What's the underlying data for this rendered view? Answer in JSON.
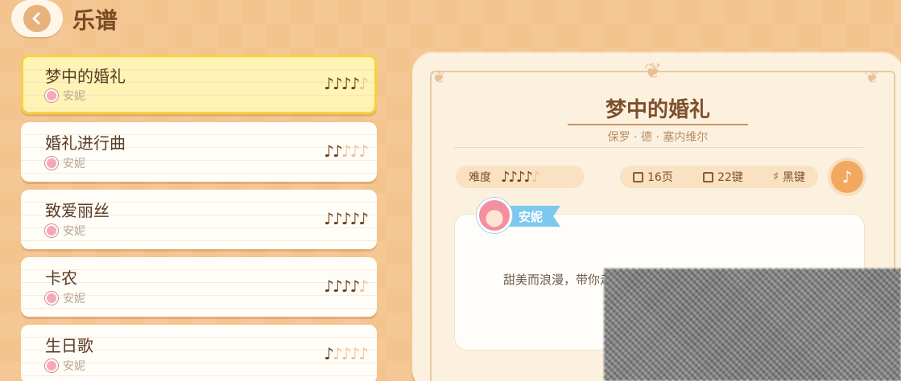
{
  "header": {
    "title": "乐谱"
  },
  "songs": [
    {
      "name": "梦中的婚礼",
      "artist": "安妮",
      "difficulty": 4,
      "max": 5,
      "selected": true
    },
    {
      "name": "婚礼进行曲",
      "artist": "安妮",
      "difficulty": 2,
      "max": 5,
      "selected": false
    },
    {
      "name": "致爱丽丝",
      "artist": "安妮",
      "difficulty": 5,
      "max": 5,
      "selected": false
    },
    {
      "name": "卡农",
      "artist": "安妮",
      "difficulty": 4,
      "max": 5,
      "selected": false
    },
    {
      "name": "生日歌",
      "artist": "安妮",
      "difficulty": 1,
      "max": 5,
      "selected": false
    }
  ],
  "detail": {
    "title": "梦中的婚礼",
    "composer": "保罗 · 德 · 塞内维尔",
    "difficulty_label": "难度",
    "difficulty": 4,
    "difficulty_max": 5,
    "pages": "16页",
    "keys": "22键",
    "key_type": "黑键",
    "speaker": "安妮",
    "description": "甜美而浪漫，带你走进爱情梦境"
  },
  "colors": {
    "background": "#f3c48e",
    "selected_border": "#f6d23e",
    "note_active": "#6d3f17",
    "note_inactive": "#ecc394",
    "speaker_tag": "#7cc8ee"
  },
  "icons": {
    "back": "chevron-left-icon",
    "note": "music-note-icon",
    "pages": "pages-icon",
    "keys": "piano-keys-icon",
    "sharp": "sharp-icon",
    "harp": "harp-icon"
  }
}
